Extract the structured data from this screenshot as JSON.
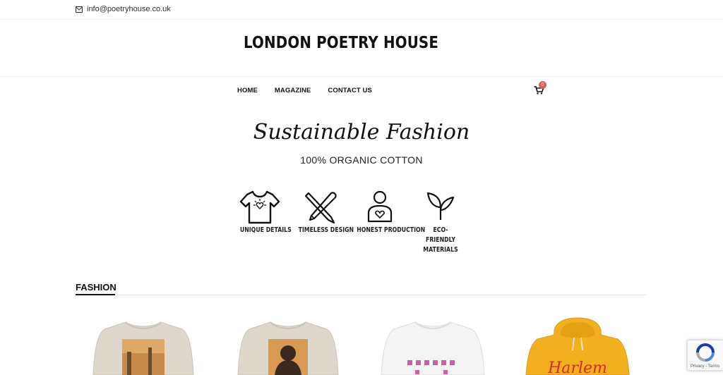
{
  "topbar": {
    "email": "info@poetryhouse.co.uk",
    "email_icon": "envelope-icon"
  },
  "header": {
    "logo": "LONDON POETRY HOUSE"
  },
  "nav": {
    "items": [
      {
        "label": "HOME"
      },
      {
        "label": "MAGAZINE"
      },
      {
        "label": "CONTACT US"
      }
    ]
  },
  "cart": {
    "count": "0",
    "icon": "cart-icon"
  },
  "hero": {
    "title": "Sustainable Fashion",
    "subtitle": "100% ORGANIC COTTON"
  },
  "features": [
    {
      "label": "UNIQUE DETAILS",
      "icon": "tshirt-icon"
    },
    {
      "label": "TIMELESS DESIGN",
      "icon": "pencil-brush-icon"
    },
    {
      "label": "HONEST PRODUCTION",
      "icon": "person-heart-icon"
    },
    {
      "label": "ECO-FRIENDLY MATERIALS",
      "icon": "leaf-sprout-icon"
    }
  ],
  "section": {
    "title": "FASHION"
  },
  "products": [
    {
      "name": "",
      "color": "#ddd7cc",
      "print": "sunset-photo"
    },
    {
      "name": "",
      "color": "#ddd7cc",
      "print": "portrait-photo"
    },
    {
      "name": "",
      "color": "#f2f2f2",
      "print": "pink-characters"
    },
    {
      "name": "",
      "color": "#f2b01e",
      "print": "Harlem"
    }
  ],
  "recaptcha": {
    "text": "Privacy - Terms"
  },
  "colors": {
    "accent": "#111111",
    "badge": "#e25b5b"
  }
}
